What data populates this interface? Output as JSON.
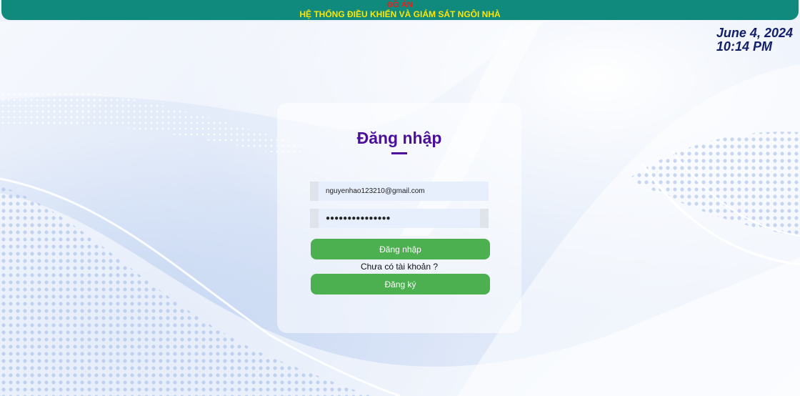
{
  "header": {
    "line1": "ĐỒ ÁN",
    "line2": "HỆ THỐNG ĐIỀU KHIỂN VÀ GIÁM SÁT NGÔI NHÀ"
  },
  "clock": {
    "date": "June 4, 2024",
    "time": "10:14 PM"
  },
  "login": {
    "title": "Đăng nhập",
    "email_value": "nguyenhao123210@gmail.com",
    "password_value": "●●●●●●●●●●●●●●●",
    "login_button": "Đăng nhập",
    "no_account_text": "Chưa có tài khoản ?",
    "register_button": "Đăng ký"
  },
  "colors": {
    "header_bg": "#118a7e",
    "header_line1": "#e52020",
    "header_line2": "#ffe600",
    "title": "#4b0f9c",
    "button": "#4caf50"
  }
}
